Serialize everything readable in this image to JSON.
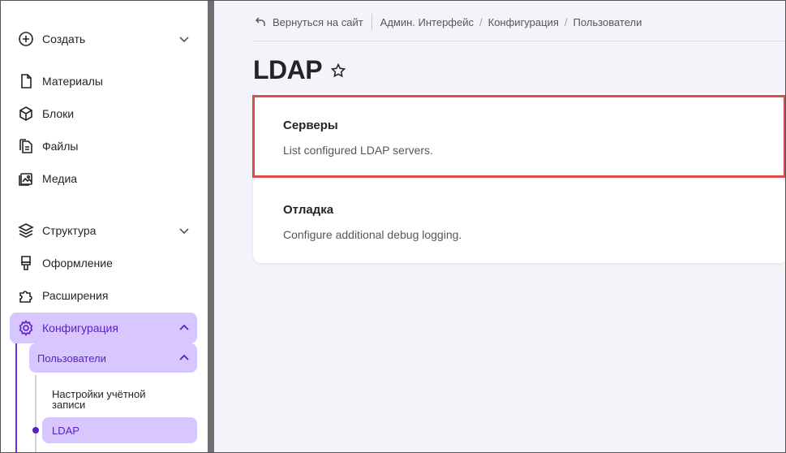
{
  "sidebar": {
    "create": "Создать",
    "items": [
      {
        "label": "Материалы",
        "icon": "file-icon"
      },
      {
        "label": "Блоки",
        "icon": "cube-icon"
      },
      {
        "label": "Файлы",
        "icon": "files-icon"
      },
      {
        "label": "Медиа",
        "icon": "image-icon"
      }
    ],
    "structure": "Структура",
    "appearance": "Оформление",
    "extensions": "Расширения",
    "configuration": "Конфигурация",
    "users": "Пользователи",
    "account_settings_line1": "Настройки учётной",
    "account_settings_line2": "записи",
    "ldap": "LDAP"
  },
  "breadcrumb": {
    "back": "Вернуться на сайт",
    "items": [
      "Админ. Интерфейс",
      "Конфигурация",
      "Пользователи"
    ]
  },
  "page": {
    "title": "LDAP",
    "cards": [
      {
        "title": "Серверы",
        "description": "List configured LDAP servers."
      },
      {
        "title": "Отладка",
        "description": "Configure additional debug logging."
      }
    ]
  },
  "colors": {
    "accent": "#5a1fc2",
    "active_bg": "#d8c6ff",
    "highlight": "#e04b4b"
  }
}
